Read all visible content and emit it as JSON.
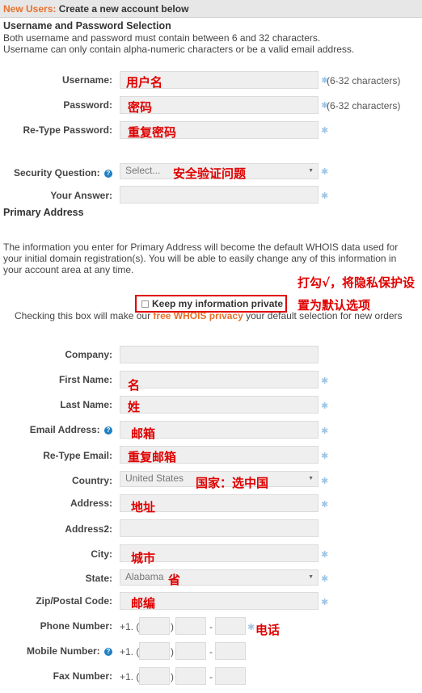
{
  "header": {
    "highlight": "New Users:",
    "title": "Create a new account below"
  },
  "credentials": {
    "title": "Username and Password Selection",
    "desc1": "Both username and password must contain between 6 and 32 characters.",
    "desc2": "Username can only contain alpha-numeric characters or be a valid email address.",
    "username_label": "Username:",
    "password_label": "Password:",
    "retype_password_label": "Re-Type Password:",
    "security_question_label": "Security Question:",
    "security_question_value": "Select...",
    "answer_label": "Your Answer:",
    "hint": "(6-32 characters)"
  },
  "primary": {
    "title": "Primary Address",
    "desc": "The information you enter for Primary Address will become the default WHOIS data used for your initial domain registration(s). You will be able to easily change any of this information in your account area at any time.",
    "privacy_label": "Keep my information private",
    "note_before": "Checking this box will make our ",
    "note_link": "free WHOIS privacy",
    "note_after": " your default selection for new orders",
    "company_label": "Company:",
    "first_name_label": "First Name:",
    "last_name_label": "Last Name:",
    "email_label": "Email Address:",
    "retype_email_label": "Re-Type Email:",
    "country_label": "Country:",
    "country_value": "United States",
    "address_label": "Address:",
    "address2_label": "Address2:",
    "city_label": "City:",
    "state_label": "State:",
    "state_value": "Alabama",
    "zip_label": "Zip/Postal Code:",
    "phone_label": "Phone Number:",
    "mobile_label": "Mobile Number:",
    "fax_label": "Fax Number:",
    "phone_prefix": "+1. (",
    "paren_close": ")",
    "dash": "-"
  },
  "annotations": {
    "username": "用户名",
    "password": "密码",
    "retype_password": "重复密码",
    "security_question": "安全验证问题",
    "privacy_line1": "打勾√，将隐私保护设",
    "privacy_line2": "置为默认选项",
    "first_name": "名",
    "last_name": "姓",
    "email": "邮箱",
    "retype_email": "重复邮箱",
    "country": "国家：选中国",
    "address": "地址",
    "city": "城市",
    "state": "省",
    "zip": "邮编",
    "phone": "电话"
  },
  "colors": {
    "accent": "#e8702a",
    "annotation": "#e00000",
    "required": "#9fc6e6",
    "help": "#1f7fc3"
  }
}
